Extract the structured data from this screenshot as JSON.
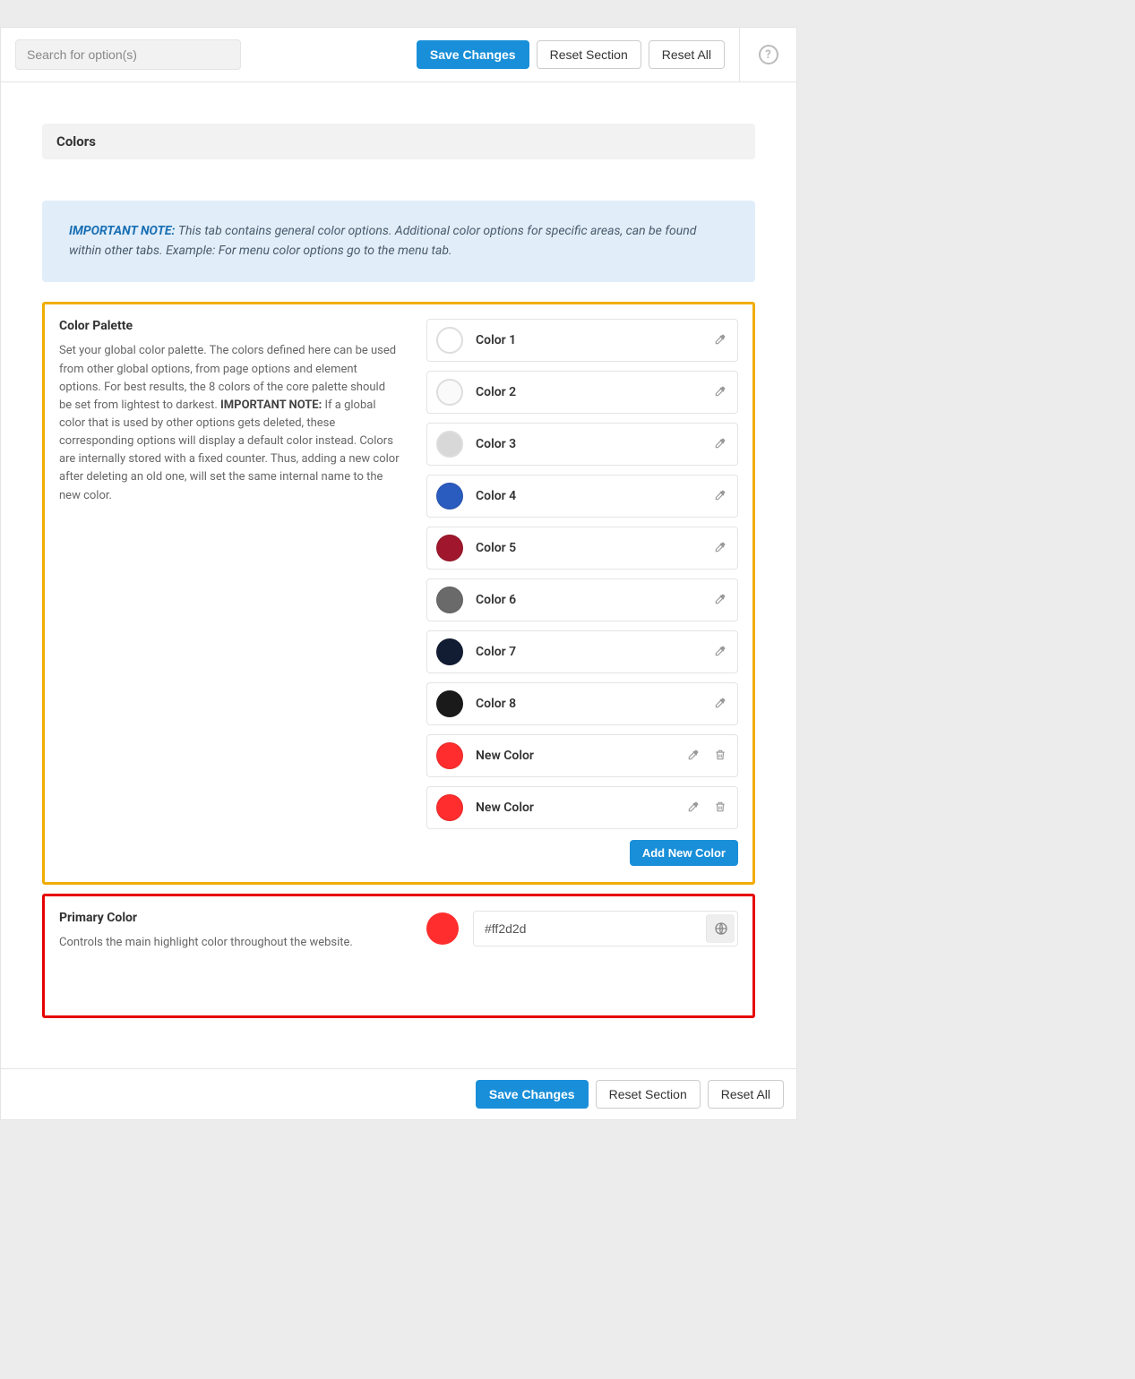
{
  "topbar": {
    "search_placeholder": "Search for option(s)",
    "save_label": "Save Changes",
    "reset_section_label": "Reset Section",
    "reset_all_label": "Reset All"
  },
  "section_title": "Colors",
  "note": {
    "title": "IMPORTANT NOTE:",
    "body": "This tab contains general color options. Additional color options for specific areas, can be found within other tabs. Example: For menu color options go to the menu tab."
  },
  "palette": {
    "title": "Color Palette",
    "desc_pre": "Set your global color palette. The colors defined here can be used from other global options, from page options and element options. For best results, the 8 colors of the core palette should be set from lightest to darkest. ",
    "desc_bold": "IMPORTANT NOTE:",
    "desc_post": " If a global color that is used by other options gets deleted, these corresponding options will display a default color instead. Colors are internally stored with a fixed counter. Thus, adding a new color after deleting an old one, will set the same internal name to the new color.",
    "colors": [
      {
        "label": "Color 1",
        "hex": "#ffffff",
        "light": true,
        "deletable": false
      },
      {
        "label": "Color 2",
        "hex": "#fafafa",
        "light": true,
        "deletable": false
      },
      {
        "label": "Color 3",
        "hex": "#d8d8d8",
        "light": true,
        "deletable": false
      },
      {
        "label": "Color 4",
        "hex": "#2a5bbf",
        "light": false,
        "deletable": false
      },
      {
        "label": "Color 5",
        "hex": "#a0172d",
        "light": false,
        "deletable": false
      },
      {
        "label": "Color 6",
        "hex": "#6a6a6a",
        "light": false,
        "deletable": false
      },
      {
        "label": "Color 7",
        "hex": "#121c33",
        "light": false,
        "deletable": false
      },
      {
        "label": "Color 8",
        "hex": "#1a1a1a",
        "light": false,
        "deletable": false
      },
      {
        "label": "New Color",
        "hex": "#ff2d2d",
        "light": false,
        "deletable": true
      },
      {
        "label": "New Color",
        "hex": "#ff2d2d",
        "light": false,
        "deletable": true
      }
    ],
    "add_label": "Add New Color"
  },
  "primary": {
    "title": "Primary Color",
    "desc": "Controls the main highlight color throughout the website.",
    "value": "#ff2d2d",
    "swatch": "#ff2d2d"
  },
  "bottombar": {
    "save_label": "Save Changes",
    "reset_section_label": "Reset Section",
    "reset_all_label": "Reset All"
  }
}
